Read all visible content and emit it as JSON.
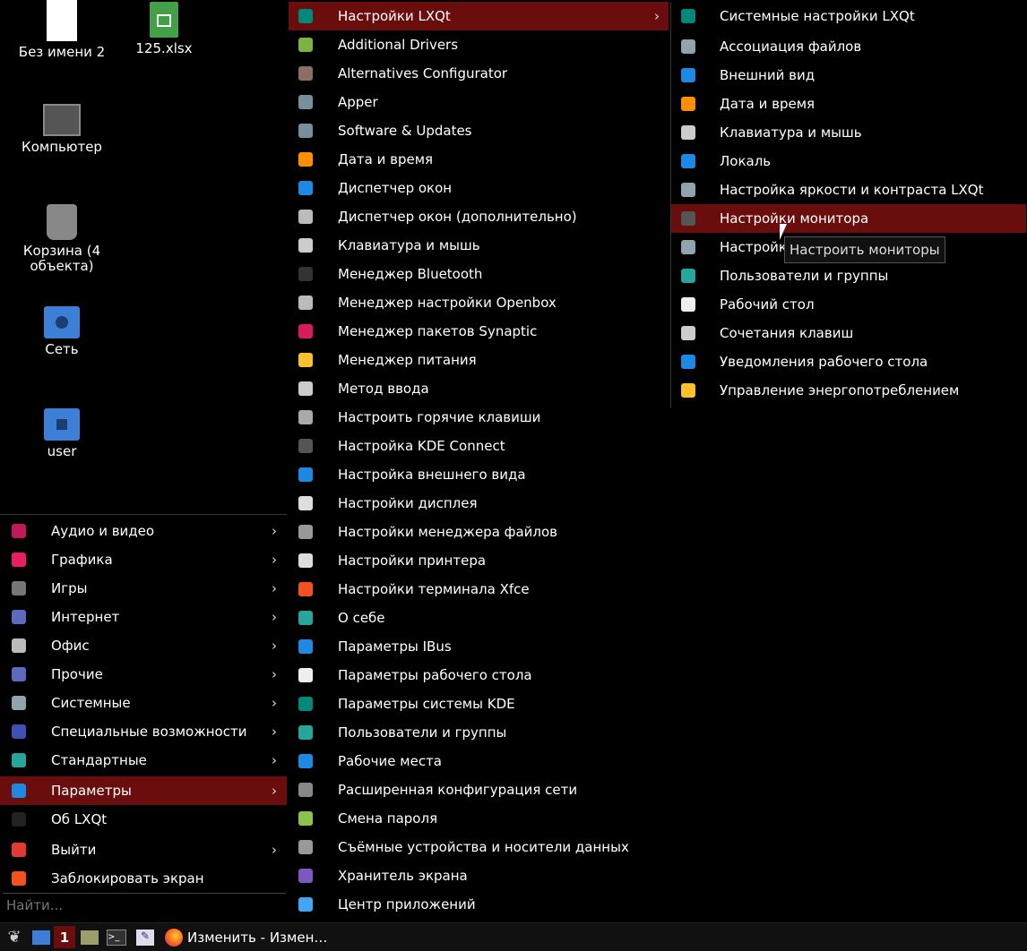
{
  "desktop": {
    "icons": [
      {
        "label": "Без имени 2",
        "icon": "document-icon"
      },
      {
        "label": "125.xlsx",
        "icon": "spreadsheet-icon"
      },
      {
        "label": "Компьютер",
        "icon": "computer-icon"
      },
      {
        "label": "Корзина (4 объекта)",
        "icon": "trash-icon"
      },
      {
        "label": "Сеть",
        "icon": "network-folder-icon"
      },
      {
        "label": "user",
        "icon": "home-folder-icon"
      }
    ]
  },
  "main_menu": {
    "items": [
      {
        "label": "Аудио и видео",
        "icon": "audio-video-icon",
        "color": "#c2185b",
        "submenu": true
      },
      {
        "label": "Графика",
        "icon": "graphics-icon",
        "color": "#e91e63",
        "submenu": true
      },
      {
        "label": "Игры",
        "icon": "gamepad-icon",
        "color": "#777777",
        "submenu": true
      },
      {
        "label": "Интернет",
        "icon": "internet-icon",
        "color": "#5c6bc0",
        "submenu": true
      },
      {
        "label": "Офис",
        "icon": "office-icon",
        "color": "#bbbbbb",
        "submenu": true
      },
      {
        "label": "Прочие",
        "icon": "other-icon",
        "color": "#5c6bc0",
        "submenu": true
      },
      {
        "label": "Системные",
        "icon": "system-gear-icon",
        "color": "#90a4ae",
        "submenu": true
      },
      {
        "label": "Специальные возможности",
        "icon": "accessibility-icon",
        "color": "#3f51b5",
        "submenu": true
      },
      {
        "label": "Стандартные",
        "icon": "accessories-icon",
        "color": "#26a69a",
        "submenu": true
      },
      {
        "label": "Параметры",
        "icon": "preferences-icon",
        "color": "#1e88e5",
        "submenu": true,
        "active": true
      },
      {
        "label": "Об LXQt",
        "icon": "info-icon",
        "color": "#222222",
        "submenu": false
      },
      {
        "label": "Выйти",
        "icon": "power-icon",
        "color": "#e53935",
        "submenu": true
      },
      {
        "label": "Заблокировать экран",
        "icon": "lock-icon",
        "color": "#f4511e",
        "submenu": false
      }
    ],
    "search_placeholder": "Найти..."
  },
  "params_menu": {
    "items": [
      {
        "label": "Настройки LXQt",
        "icon": "lxqt-icon",
        "color": "#00897b",
        "submenu": true,
        "active": true
      },
      {
        "label": "Additional Drivers",
        "icon": "chip-icon",
        "color": "#7cb342"
      },
      {
        "label": "Alternatives Configurator",
        "icon": "alternatives-icon",
        "color": "#8d6e63"
      },
      {
        "label": "Apper",
        "icon": "download-icon",
        "color": "#78909c"
      },
      {
        "label": "Software & Updates",
        "icon": "updates-icon",
        "color": "#78909c"
      },
      {
        "label": "Дата и время",
        "icon": "clock-icon",
        "color": "#ff8f00"
      },
      {
        "label": "Диспетчер окон",
        "icon": "window-manager-icon",
        "color": "#1e88e5"
      },
      {
        "label": "Диспетчер окон (дополнительно)",
        "icon": "windows-icon",
        "color": "#bbbbbb"
      },
      {
        "label": "Клавиатура и мышь",
        "icon": "keyboard-icon",
        "color": "#cccccc"
      },
      {
        "label": "Менеджер Bluetooth",
        "icon": "bluetooth-icon",
        "color": "#333333"
      },
      {
        "label": "Менеджер настройки Openbox",
        "icon": "openbox-icon",
        "color": "#bbbbbb"
      },
      {
        "label": "Менеджер пакетов Synaptic",
        "icon": "synaptic-icon",
        "color": "#d81b60"
      },
      {
        "label": "Менеджер питания",
        "icon": "power-manager-icon",
        "color": "#fbc02d"
      },
      {
        "label": "Метод ввода",
        "icon": "input-method-icon",
        "color": "#cccccc"
      },
      {
        "label": "Настроить горячие клавиши",
        "icon": "hotkeys-icon",
        "color": "#aaaaaa"
      },
      {
        "label": "Настройка KDE Connect",
        "icon": "kdeconnect-icon",
        "color": "#555555"
      },
      {
        "label": "Настройка внешнего вида",
        "icon": "appearance-icon",
        "color": "#1e88e5"
      },
      {
        "label": "Настройки дисплея",
        "icon": "display-icon",
        "color": "#dddddd"
      },
      {
        "label": "Настройки менеджера файлов",
        "icon": "file-manager-icon",
        "color": "#999999"
      },
      {
        "label": "Настройки принтера",
        "icon": "printer-icon",
        "color": "#dddddd"
      },
      {
        "label": "Настройки терминала Xfce",
        "icon": "terminal-settings-icon",
        "color": "#f4511e"
      },
      {
        "label": "О себе",
        "icon": "user-icon",
        "color": "#26a69a"
      },
      {
        "label": "Параметры IBus",
        "icon": "ibus-info-icon",
        "color": "#1e88e5"
      },
      {
        "label": "Параметры рабочего стола",
        "icon": "desktop-settings-icon",
        "color": "#eeeeee"
      },
      {
        "label": "Параметры системы KDE",
        "icon": "kde-settings-icon",
        "color": "#00897b"
      },
      {
        "label": "Пользователи и группы",
        "icon": "users-icon",
        "color": "#26a69a"
      },
      {
        "label": "Рабочие места",
        "icon": "workspaces-icon",
        "color": "#1e88e5"
      },
      {
        "label": "Расширенная конфигурация сети",
        "icon": "network-icon",
        "color": "#888888"
      },
      {
        "label": "Смена пароля",
        "icon": "key-icon",
        "color": "#8bc34a"
      },
      {
        "label": "Съёмные устройства и носители данных",
        "icon": "removable-media-icon",
        "color": "#999999"
      },
      {
        "label": "Хранитель экрана",
        "icon": "screensaver-icon",
        "color": "#7e57c2"
      },
      {
        "label": "Центр приложений",
        "icon": "app-center-icon",
        "color": "#42a5f5"
      }
    ]
  },
  "lxqt_menu": {
    "items": [
      {
        "label": "Системные настройки LXQt",
        "icon": "lxqt-icon",
        "color": "#00897b"
      },
      {
        "label": "Ассоциация файлов",
        "icon": "gear-icon",
        "color": "#90a4ae"
      },
      {
        "label": "Внешний вид",
        "icon": "appearance-icon",
        "color": "#1e88e5"
      },
      {
        "label": "Дата и время",
        "icon": "clock-icon",
        "color": "#ff8f00"
      },
      {
        "label": "Клавиатура и мышь",
        "icon": "mouse-icon",
        "color": "#cccccc"
      },
      {
        "label": "Локаль",
        "icon": "locale-icon",
        "color": "#1e88e5"
      },
      {
        "label": "Настройка яркости и контраста LXQt",
        "icon": "brightness-icon",
        "color": "#90a4ae"
      },
      {
        "label": "Настройки монитора",
        "icon": "monitor-icon",
        "color": "#555555",
        "active": true
      },
      {
        "label": "Настройки",
        "icon": "gear-icon",
        "color": "#90a4ae"
      },
      {
        "label": "Пользователи и группы",
        "icon": "users-icon",
        "color": "#26a69a"
      },
      {
        "label": "Рабочий стол",
        "icon": "desktop-icon",
        "color": "#eeeeee"
      },
      {
        "label": "Сочетания клавиш",
        "icon": "keyboard-icon",
        "color": "#cccccc"
      },
      {
        "label": "Уведомления рабочего стола",
        "icon": "notification-icon",
        "color": "#1e88e5"
      },
      {
        "label": "Управление энергопотреблением",
        "icon": "power-manager-icon",
        "color": "#fbc02d"
      }
    ]
  },
  "tooltip": {
    "text": "Настроить мониторы"
  },
  "taskbar": {
    "workspace": "1",
    "task_label": "Изменить - Измен…"
  }
}
